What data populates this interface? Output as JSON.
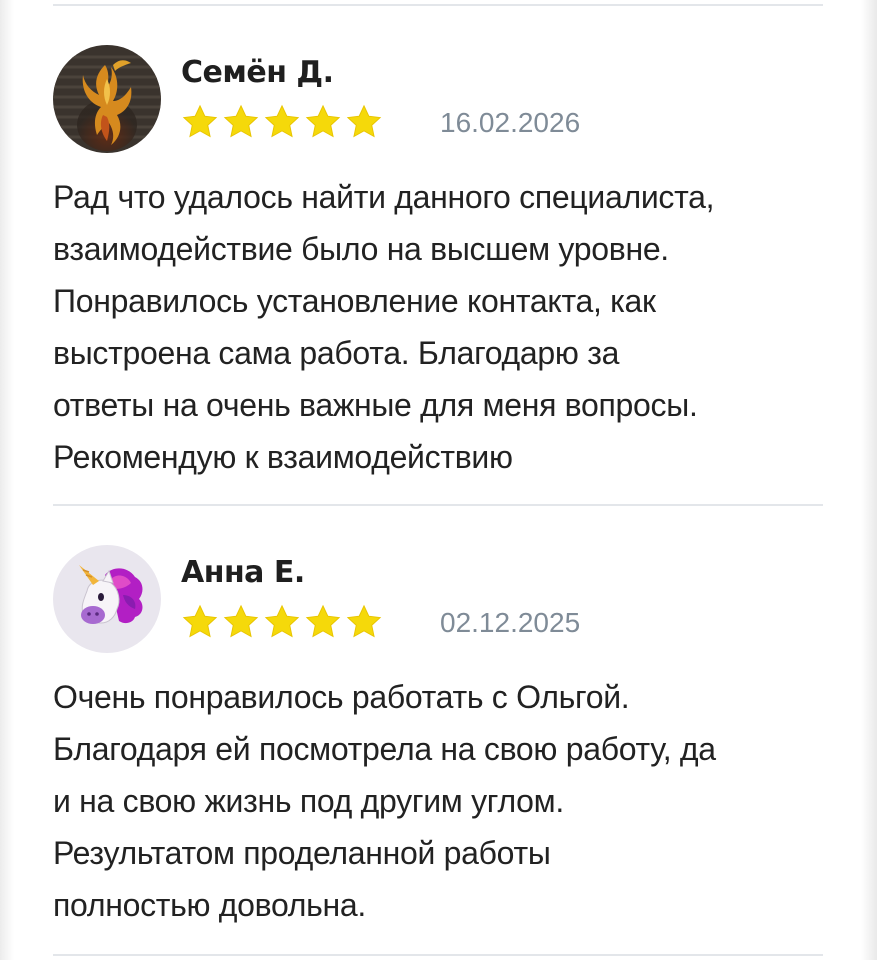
{
  "reviews": [
    {
      "author": "Семён Д.",
      "avatar_icon": "phoenix-avatar-icon",
      "rating": 5,
      "date": "16.02.2026",
      "text_lines": [
        "Рад что удалось найти данного специалиста,",
        "взаимодействие было на высшем уровне.",
        "Понравилось установление контакта, как",
        "выстроена сама работа. Благодарю за",
        "ответы на очень важные для меня вопросы.",
        "Рекомендую к взаимодействию"
      ]
    },
    {
      "author": "Анна Е.",
      "avatar_icon": "unicorn-avatar-icon",
      "rating": 5,
      "date": "02.12.2025",
      "text_lines": [
        "Очень понравилось работать с Ольгой.",
        "Благодаря ей посмотрела на свою работу, да",
        "и на свою жизнь под другим углом.",
        "Результатом проделанной работы",
        "полностью довольна."
      ]
    }
  ],
  "colors": {
    "star": "#f5d90a",
    "star_outline": "#e8c400",
    "date": "#7f8b97",
    "divider": "#e3e6ea"
  }
}
